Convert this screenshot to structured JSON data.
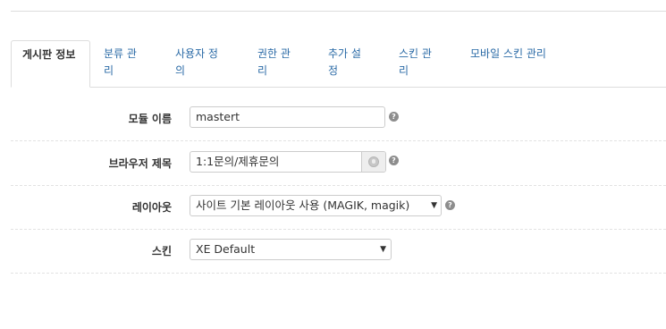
{
  "tabs": [
    {
      "label": "게시판 정보",
      "active": true
    },
    {
      "label": "분류 관리"
    },
    {
      "label": "사용자 정의"
    },
    {
      "label": "권한 관리"
    },
    {
      "label": "추가 설정"
    },
    {
      "label": "스킨 관리"
    },
    {
      "label": "모바일 스킨 관리"
    }
  ],
  "form": {
    "module_name": {
      "label": "모듈 이름",
      "value": "mastert"
    },
    "browser_title": {
      "label": "브라우저 제목",
      "value": "1:1문의/제휴문의"
    },
    "layout": {
      "label": "레이아웃",
      "value": "사이트 기본 레이아웃 사용 (MAGIK, magik)"
    },
    "skin": {
      "label": "스킨",
      "value": "XE Default"
    }
  },
  "icons": {
    "help": "help-icon",
    "globe": "globe-icon",
    "dropdown": "chevron-down-icon"
  },
  "help_glyph": "?",
  "dropdown_glyph": "▼"
}
